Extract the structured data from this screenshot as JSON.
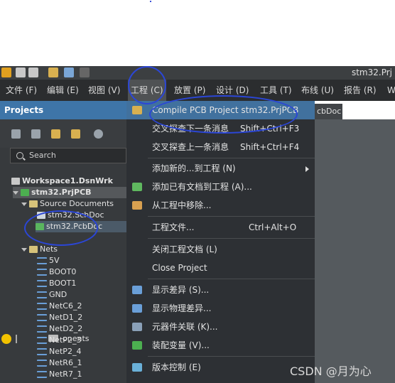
{
  "window": {
    "title": "stm32.Prj"
  },
  "menubar": [
    {
      "label": "文件 (F)"
    },
    {
      "label": "编辑 (E)"
    },
    {
      "label": "视图 (V)"
    },
    {
      "label": "工程 (C)"
    },
    {
      "label": "放置 (P)"
    },
    {
      "label": "设计 (D)"
    },
    {
      "label": "工具 (T)"
    },
    {
      "label": "布线 (U)"
    },
    {
      "label": "报告 (R)"
    },
    {
      "label": "W"
    }
  ],
  "panel": {
    "title": "Projects",
    "search_placeholder": "Search",
    "tree": [
      {
        "label": "Workspace1.DsnWrk",
        "icon": "workspace-icon"
      },
      {
        "label": "stm32.PrjPCB",
        "icon": "project-icon"
      },
      {
        "label": "Source Documents",
        "icon": "folder-icon"
      },
      {
        "label": "stm32.SchDoc",
        "icon": "schematic-doc-icon"
      },
      {
        "label": "stm32.PcbDoc",
        "icon": "pcb-doc-icon"
      },
      {
        "label": "Components",
        "icon": "components-icon"
      },
      {
        "label": "Nets",
        "icon": "folder-icon"
      }
    ],
    "nets": [
      "5V",
      "BOOT0",
      "BOOT1",
      "GND",
      "NetC6_2",
      "NetD1_2",
      "NetD2_2",
      "NetP2_3",
      "NetP2_4",
      "NetR6_1",
      "NetR7_1"
    ],
    "components_visible": "onents"
  },
  "doc_tab": {
    "label": "cbDoc"
  },
  "dropdown": {
    "items": [
      {
        "label": "Compile PCB Project stm32.PrjPCB",
        "shortcut": "",
        "icon": "compile-icon",
        "highlighted": true
      },
      {
        "label": "交叉探查下一条消息",
        "shortcut": "Shift+Ctrl+F3"
      },
      {
        "label": "交叉探查上一条消息",
        "shortcut": "Shift+Ctrl+F4"
      },
      {
        "label": "添加新的...到工程 (N)",
        "shortcut": "",
        "submenu": true
      },
      {
        "label": "添加已有文档到工程 (A)...",
        "shortcut": "",
        "icon": "add-existing-icon"
      },
      {
        "label": "从工程中移除...",
        "shortcut": "",
        "icon": "remove-icon"
      },
      {
        "label": "工程文件...",
        "shortcut": "Ctrl+Alt+O"
      },
      {
        "label": "关闭工程文档 (L)",
        "shortcut": ""
      },
      {
        "label": "Close Project",
        "shortcut": ""
      },
      {
        "label": "显示差异 (S)...",
        "shortcut": "",
        "icon": "diff-icon"
      },
      {
        "label": "显示物理差异...",
        "shortcut": "",
        "icon": "physical-diff-icon"
      },
      {
        "label": "元器件关联 (K)...",
        "shortcut": "",
        "icon": "component-link-icon"
      },
      {
        "label": "装配变量 (V)...",
        "shortcut": "",
        "icon": "variant-icon"
      },
      {
        "label": "版本控制 (E)",
        "shortcut": "",
        "icon": "version-control-icon"
      }
    ]
  },
  "watermark": "CSDN @月为心",
  "colors": {
    "accent": "#41719e",
    "panel_header": "#3e75a8",
    "annotation": "#2b46d6"
  }
}
